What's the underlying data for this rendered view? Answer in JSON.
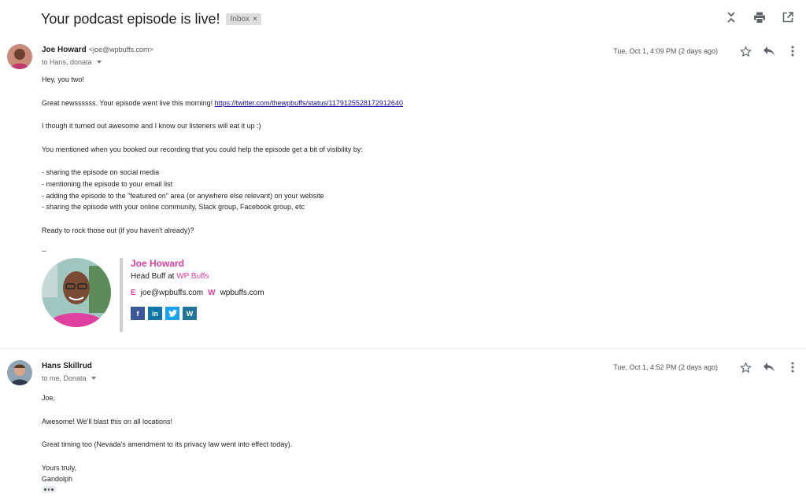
{
  "thread": {
    "subject": "Your podcast episode is live!",
    "label": "Inbox",
    "label_close": "×"
  },
  "messages": [
    {
      "sender_name": "Joe Howard",
      "sender_email": "<joe@wpbuffs.com>",
      "to": "to Hans, donata",
      "date": "Tue, Oct 1, 4:09 PM (2 days ago)",
      "body": {
        "greeting": "Hey, you two!",
        "line1_text": "Great newssssss. Your episode went live this morning! ",
        "line1_link": "https://twitter.com/thewpbuffs/status/1179125528172912640",
        "line2": "I though it turned out awesome and I know our listeners will eat it up :)",
        "line3": "You mentioned when you booked our recording that you could help the episode get a bit of visibility by:",
        "bullets": [
          "- sharing the episode on social media",
          "- mentioning the episode to your email list",
          "- adding the episode to the \"featured on\" area (or anywhere else relevant) on your website",
          "- sharing the episode with your online community, Slack group, Facebook group, etc"
        ],
        "closing": "Ready to rock those out (if you haven't already)?"
      },
      "signature": {
        "dash": "--",
        "name": "Joe Howard",
        "title_prefix": "Head Buff at ",
        "company": "WP Buffs",
        "email_letter": "E",
        "email": "joe@wpbuffs.com",
        "web_letter": "W",
        "website": "wpbuffs.com",
        "social": [
          "f",
          "in",
          "t",
          "W"
        ]
      }
    },
    {
      "sender_name": "Hans Skillrud",
      "to": "to me, Donata",
      "date": "Tue, Oct 1, 4:52 PM (2 days ago)",
      "body": {
        "greeting": "Joe,",
        "line1": "Awesome!  We'll blast this on all locations!",
        "line2": "Great timing too (Nevada's amendment to its privacy law went into effect today).",
        "signoff1": "Yours truly,",
        "signoff2": "Gandolph"
      }
    }
  ],
  "icons": {
    "collapse": "collapse-all-icon",
    "print": "print-icon",
    "new_window": "open-in-new-window-icon",
    "star": "star-icon",
    "reply": "reply-icon",
    "more": "more-vert-icon"
  },
  "colors": {
    "signature_accent": "#e0409d",
    "link": "#1a0dab",
    "facebook": "#3b5998",
    "linkedin": "#0e76a8",
    "twitter": "#1da1f2",
    "wordpress": "#21759b"
  }
}
